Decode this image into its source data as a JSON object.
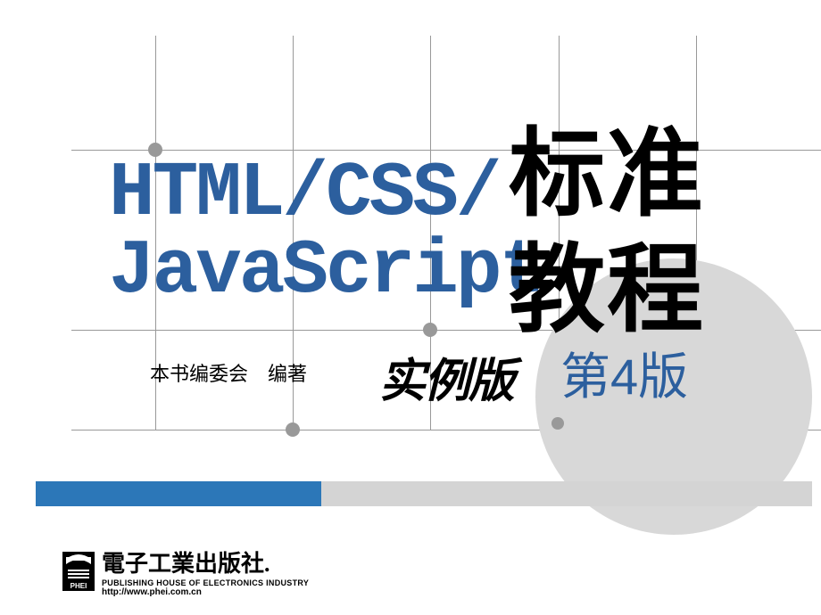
{
  "title": {
    "en_line1": "HTML/CSS/",
    "en_line2": "JavaScript",
    "cn_line1": "标准",
    "cn_line2": "教程"
  },
  "author_label": "本书编委会　编著",
  "example_edition": "实例版",
  "edition_number": "第4版",
  "publisher": {
    "name_cn": "電子工業出版社.",
    "name_en": "PUBLISHING HOUSE OF ELECTRONICS INDUSTRY",
    "url": "http://www.phei.com.cn",
    "logo_label": "PHEI"
  },
  "colors": {
    "brand_blue": "#2c5f9e",
    "bar_blue": "#2c77b8",
    "bar_gray": "#d4d4d4",
    "grid_gray": "#999",
    "circle_gray": "#d8d8d8"
  }
}
